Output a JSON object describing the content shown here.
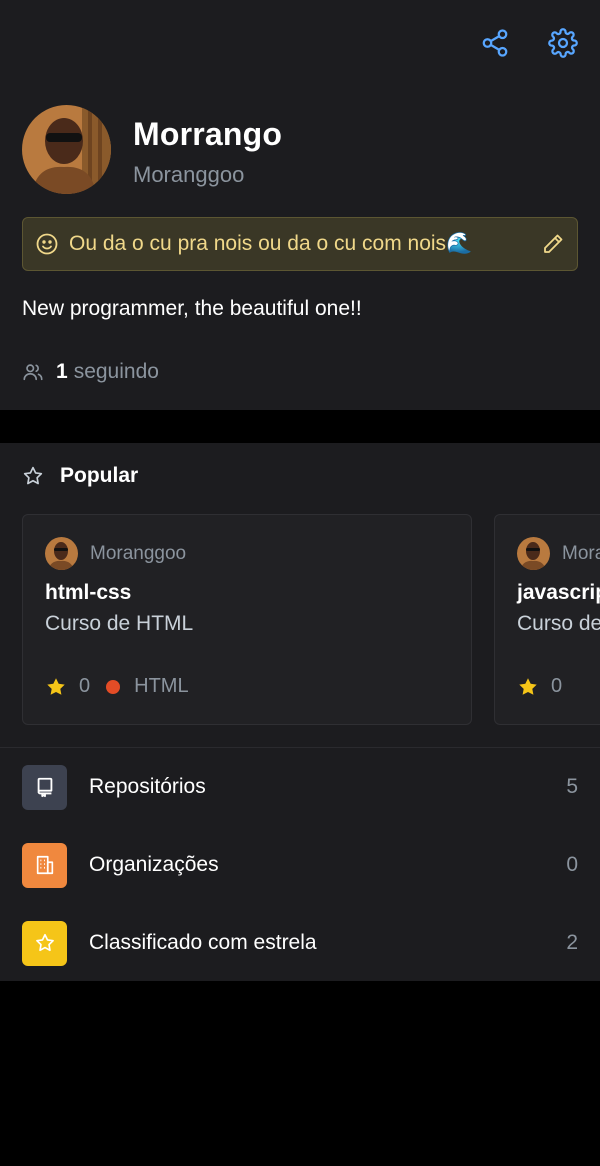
{
  "profile": {
    "name": "Morrango",
    "login": "Moranggoo",
    "status": "Ou da o cu pra nois ou da o cu com nois🌊",
    "bio": "New programmer, the beautiful one!!",
    "following_count": "1",
    "following_label": "seguindo"
  },
  "popular": {
    "title": "Popular",
    "cards": [
      {
        "owner": "Moranggoo",
        "name": "html-css",
        "description": "Curso de HTML",
        "stars": "0",
        "language": "HTML",
        "language_color": "#e34c26"
      },
      {
        "owner": "Moranggoo",
        "name": "javascript",
        "description": "Curso de JavaScript",
        "stars": "0"
      }
    ]
  },
  "menu": [
    {
      "label": "Repositórios",
      "count": "5",
      "icon": "repo-icon",
      "color": "#3d4250"
    },
    {
      "label": "Organizações",
      "count": "0",
      "icon": "organization-icon",
      "color": "#f0883e"
    },
    {
      "label": "Classificado com estrela",
      "count": "2",
      "icon": "star-icon",
      "color": "#f5c518"
    }
  ],
  "colors": {
    "panel": "#1c1c1f",
    "accent": "#58a6ff",
    "status_bg": "#3a3726"
  }
}
